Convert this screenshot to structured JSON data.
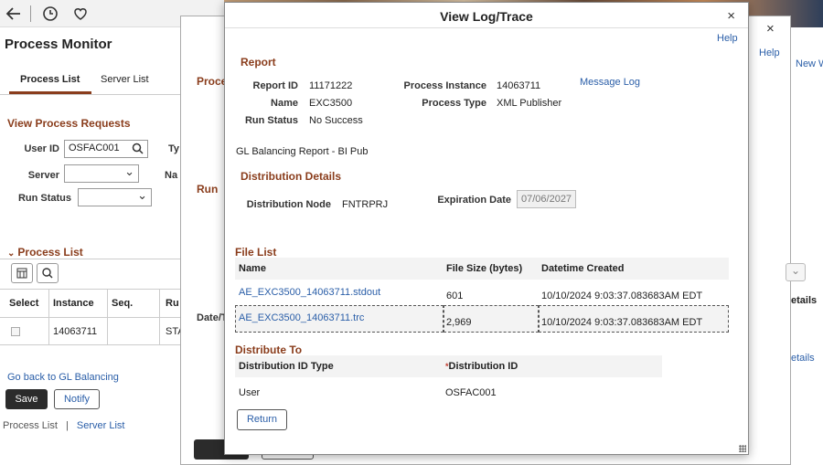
{
  "toolbar": {
    "back_icon": "back-arrow-icon",
    "history_icon": "clock-icon",
    "favorite_icon": "heart-icon"
  },
  "background": {
    "title": "Process Monitor",
    "tabs": [
      "Process List",
      "Server List"
    ],
    "view_requests_heading": "View Process Requests",
    "user_id_label": "User ID",
    "user_id_value": "OSFAC001",
    "server_label": "Server",
    "run_status_label": "Run Status",
    "ty_label": "Ty",
    "na_label": "Na",
    "process_list_heading": "Process List",
    "grid_headers": [
      "Select",
      "Instance",
      "Seq.",
      "Ru"
    ],
    "grid_row": {
      "instance": "14063711",
      "run": "STA"
    },
    "back_link": "Go back to GL Balancing",
    "save_button": "Save",
    "notify_button": "Notify",
    "footer_links": [
      "Process List",
      "Server List"
    ],
    "footer_sep": "|"
  },
  "mid": {
    "process_label": "Proce",
    "run_label": "Run",
    "datetime_label": "Date/T",
    "help": "Help",
    "close": "×",
    "new_window": "New W",
    "details_header": "etails",
    "details_link": "etails"
  },
  "modal": {
    "title": "View Log/Trace",
    "help": "Help",
    "close": "×",
    "report_heading": "Report",
    "report_id_label": "Report ID",
    "report_id": "11171222",
    "process_instance_label": "Process Instance",
    "process_instance": "14063711",
    "message_log_link": "Message Log",
    "name_label": "Name",
    "name": "EXC3500",
    "process_type_label": "Process Type",
    "process_type": "XML Publisher",
    "run_status_label": "Run Status",
    "run_status": "No Success",
    "description": "GL Balancing Report - BI Pub",
    "distribution_heading": "Distribution Details",
    "distribution_node_label": "Distribution Node",
    "distribution_node": "FNTRPRJ",
    "expiration_date_label": "Expiration Date",
    "expiration_date": "07/06/2027",
    "file_list_heading": "File List",
    "file_headers": [
      "Name",
      "File Size (bytes)",
      "Datetime Created"
    ],
    "files": [
      {
        "name": "AE_EXC3500_14063711.stdout",
        "size": "601",
        "created": "10/10/2024  9:03:37.083683AM EDT"
      },
      {
        "name": "AE_EXC3500_14063711.trc",
        "size": "2,969",
        "created": "10/10/2024  9:03:37.083683AM EDT"
      }
    ],
    "distribute_to_heading": "Distribute To",
    "dist_headers": [
      "Distribution ID Type",
      "Distribution ID"
    ],
    "required_marker": "*",
    "dist_rows": [
      {
        "type": "User",
        "id": "OSFAC001"
      }
    ],
    "return_button": "Return"
  }
}
